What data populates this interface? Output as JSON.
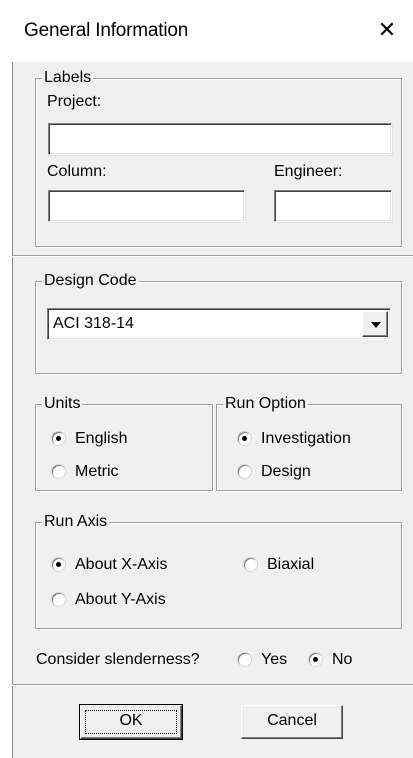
{
  "window": {
    "title": "General Information",
    "close_glyph": "✕"
  },
  "labels_group": {
    "legend": "Labels",
    "project_label": "Project:",
    "project_value": "",
    "column_label": "Column:",
    "column_value": "",
    "engineer_label": "Engineer:",
    "engineer_value": ""
  },
  "design_code": {
    "legend": "Design Code",
    "selected": "ACI 318-14"
  },
  "units": {
    "legend": "Units",
    "options": [
      "English",
      "Metric"
    ],
    "selected": "English"
  },
  "run_option": {
    "legend": "Run Option",
    "options": [
      "Investigation",
      "Design"
    ],
    "selected": "Investigation"
  },
  "run_axis": {
    "legend": "Run Axis",
    "options": [
      "About X-Axis",
      "Biaxial",
      "About Y-Axis"
    ],
    "selected": "About X-Axis"
  },
  "slenderness": {
    "label": "Consider slenderness?",
    "yes": "Yes",
    "no": "No",
    "selected": "No"
  },
  "buttons": {
    "ok": "OK",
    "cancel": "Cancel"
  }
}
